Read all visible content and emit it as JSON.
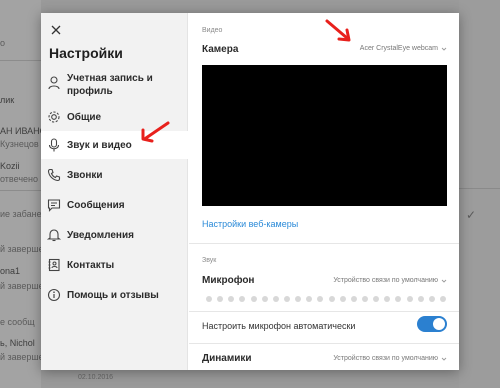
{
  "background": {
    "lines": [
      "",
      "о",
      "",
      "",
      "лик",
      "",
      "АН ИВАНОВ",
      "Кузнецов",
      "Kozii",
      "отвечено",
      "",
      "ие забанен",
      "",
      "й завершен",
      "",
      "ona1",
      "й завершен",
      "",
      "е сообщ",
      "",
      "ь, Nichol",
      "й завершен"
    ],
    "timestamp": "02.10.2016"
  },
  "dialog": {
    "title": "Настройки",
    "close_icon": "close-icon",
    "nav": [
      {
        "label": "Учетная запись и профиль",
        "icon": "avatar-icon"
      },
      {
        "label": "Общие",
        "icon": "gear-icon"
      },
      {
        "label": "Звук и видео",
        "icon": "microphone-icon",
        "active": true
      },
      {
        "label": "Звонки",
        "icon": "phone-icon"
      },
      {
        "label": "Сообщения",
        "icon": "chat-icon"
      },
      {
        "label": "Уведомления",
        "icon": "bell-icon"
      },
      {
        "label": "Контакты",
        "icon": "contacts-icon"
      },
      {
        "label": "Помощь и отзывы",
        "icon": "info-icon"
      }
    ],
    "video": {
      "section": "Видео",
      "camera_label": "Камера",
      "camera_value": "Acer CrystalEye webcam",
      "webcam_settings_link": "Настройки веб-камеры"
    },
    "audio": {
      "section": "Звук",
      "microphone_label": "Микрофон",
      "microphone_value": "Устройство связи по умолчанию",
      "auto_adjust_label": "Настроить микрофон автоматически",
      "auto_adjust_on": true,
      "speakers_label": "Динамики",
      "speakers_value": "Устройство связи по умолчанию"
    }
  },
  "colors": {
    "accent": "#2b80d0",
    "annotation": "#e8201c"
  }
}
